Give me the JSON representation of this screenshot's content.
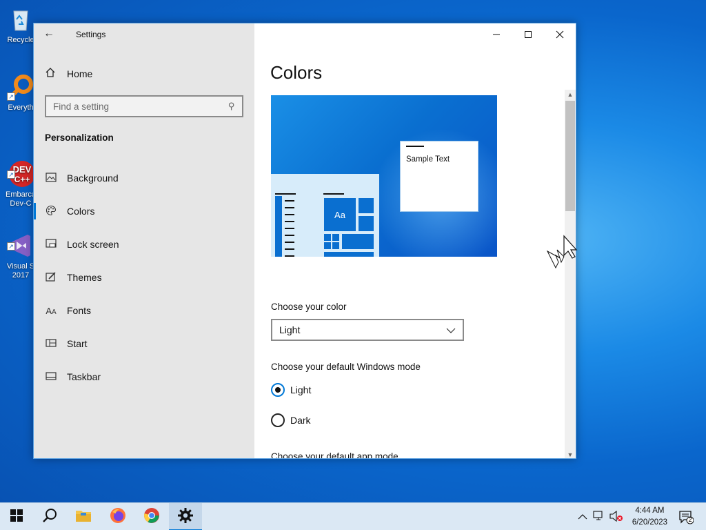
{
  "desktop": {
    "icons": [
      {
        "label": "Recycle",
        "icon": "recycle-bin-icon"
      },
      {
        "label": "Everyth",
        "icon": "everything-search-icon"
      },
      {
        "label": "Embarca\nDev-C",
        "icon": "devcpp-icon",
        "badge": "DEV C++"
      },
      {
        "label": "Visual S\n2017",
        "icon": "visual-studio-icon"
      }
    ]
  },
  "window": {
    "title": "Settings",
    "controls": {
      "minimize": "—",
      "maximize": "□",
      "close": "✕"
    }
  },
  "sidebar": {
    "back": "←",
    "home_label": "Home",
    "search_placeholder": "Find a setting",
    "section": "Personalization",
    "items": [
      {
        "label": "Background",
        "icon": "image-icon"
      },
      {
        "label": "Colors",
        "icon": "palette-icon",
        "active": true
      },
      {
        "label": "Lock screen",
        "icon": "lock-screen-icon"
      },
      {
        "label": "Themes",
        "icon": "themes-icon"
      },
      {
        "label": "Fonts",
        "icon": "fonts-icon"
      },
      {
        "label": "Start",
        "icon": "start-icon"
      },
      {
        "label": "Taskbar",
        "icon": "taskbar-icon"
      }
    ]
  },
  "content": {
    "title": "Colors",
    "preview": {
      "sample_text": "Sample Text",
      "tile_text": "Aa"
    },
    "choose_color_label": "Choose your color",
    "color_value": "Light",
    "windows_mode_label": "Choose your default Windows mode",
    "windows_mode_options": [
      {
        "label": "Light",
        "checked": true
      },
      {
        "label": "Dark",
        "checked": false
      }
    ],
    "app_mode_label": "Choose your default app mode"
  },
  "taskbar": {
    "apps": [
      {
        "name": "start",
        "icon": "windows-logo-icon"
      },
      {
        "name": "search",
        "icon": "search-icon"
      },
      {
        "name": "file-explorer",
        "icon": "folder-icon"
      },
      {
        "name": "firefox",
        "icon": "firefox-icon"
      },
      {
        "name": "chrome",
        "icon": "chrome-icon"
      },
      {
        "name": "settings",
        "icon": "gear-icon",
        "active": true
      }
    ],
    "time": "4:44 AM",
    "date": "6/20/2023",
    "notification_count": "2"
  },
  "colors": {
    "accent": "#0078d7",
    "sidebar_bg": "#e6e6e6",
    "taskbar_bg": "#dbe8f4"
  }
}
